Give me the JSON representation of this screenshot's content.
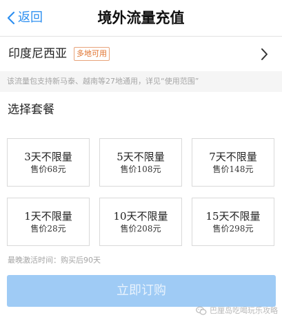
{
  "header": {
    "back_label": "返回",
    "title": "境外流量充值"
  },
  "region": {
    "name": "印度尼西亚",
    "badge": "多地可用"
  },
  "note": "该流量包支持新马泰、越南等27地通用，详见“使用范围”",
  "plans_section": {
    "title": "选择套餐",
    "plans": [
      {
        "name": "3天不限量",
        "price": "售价68元"
      },
      {
        "name": "5天不限量",
        "price": "售价108元"
      },
      {
        "name": "7天不限量",
        "price": "售价148元"
      },
      {
        "name": "1天不限量",
        "price": "售价28元"
      },
      {
        "name": "10天不限量",
        "price": "售价208元"
      },
      {
        "name": "15天不限量",
        "price": "售价298元"
      }
    ]
  },
  "deadline": "最晚激活时间：购买后90天",
  "buy_button_label": "立即订购",
  "watermark": "巴厘岛吃喝玩乐攻略",
  "colors": {
    "accent": "#2d8ff0",
    "badge": "#e0712c",
    "button_disabled": "#9fcbf5"
  },
  "icons": {
    "back": "chevron-left-icon",
    "region": "chevron-right-icon",
    "watermark": "wechat-icon"
  }
}
